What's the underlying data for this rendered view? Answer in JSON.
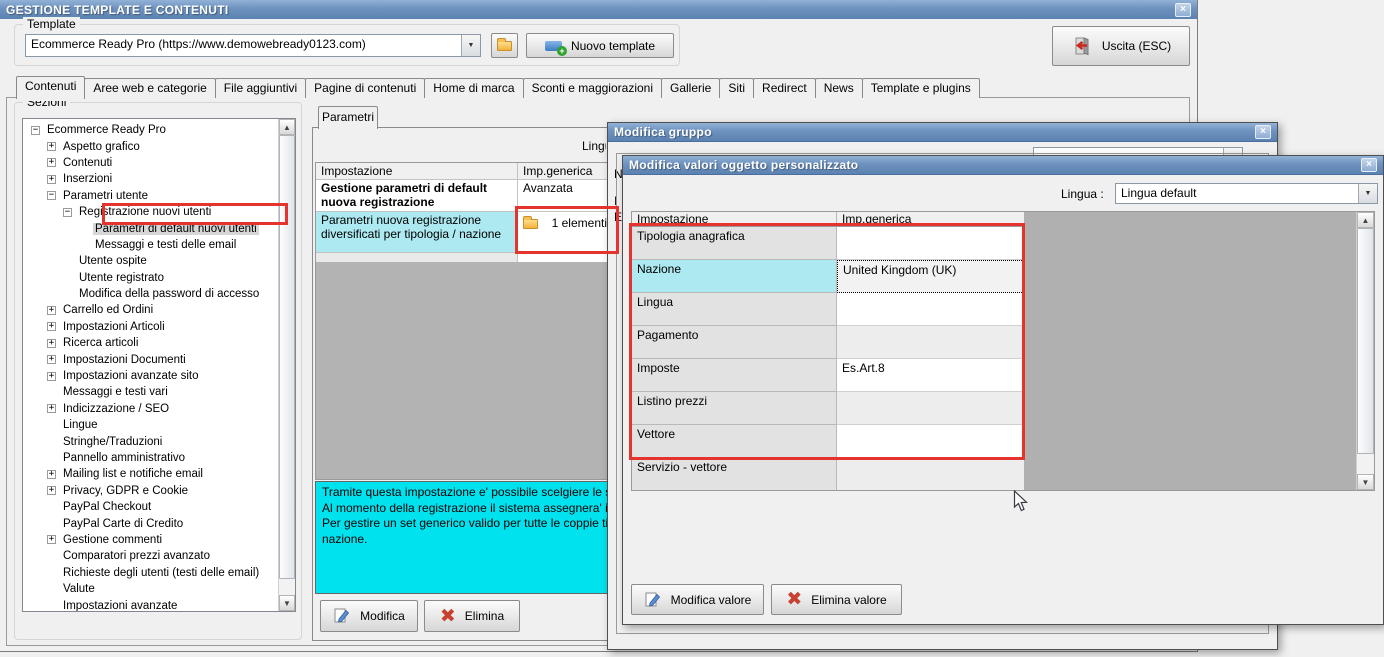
{
  "window": {
    "title": "GESTIONE TEMPLATE E CONTENUTI",
    "template_group": {
      "label": "Template",
      "combo_value": "Ecommerce Ready Pro (https://www.demowebready0123.com)",
      "new_template_label": "Nuovo template"
    },
    "exit_label": "Uscita (ESC)",
    "tabs": [
      "Contenuti",
      "Aree web e categorie",
      "File aggiuntivi",
      "Pagine di contenuti",
      "Home di marca",
      "Sconti e maggiorazioni",
      "Gallerie",
      "Siti",
      "Redirect",
      "News",
      "Template e plugins"
    ],
    "active_tab": "Contenuti"
  },
  "sections": {
    "label": "Sezioni",
    "tree": [
      {
        "label": "Ecommerce Ready Pro",
        "level": 0,
        "state": "minus"
      },
      {
        "label": "Aspetto grafico",
        "level": 1,
        "state": "plus"
      },
      {
        "label": "Contenuti",
        "level": 1,
        "state": "plus"
      },
      {
        "label": "Inserzioni",
        "level": 1,
        "state": "plus"
      },
      {
        "label": "Parametri utente",
        "level": 1,
        "state": "minus"
      },
      {
        "label": "Registrazione nuovi utenti",
        "level": 2,
        "state": "minus"
      },
      {
        "label": "Parametri di default nuovi utenti",
        "level": 3,
        "state": "leaf",
        "selected": true
      },
      {
        "label": "Messaggi e testi delle email",
        "level": 3,
        "state": "leaf"
      },
      {
        "label": "Utente ospite",
        "level": 2,
        "state": "leaf"
      },
      {
        "label": "Utente registrato",
        "level": 2,
        "state": "leaf"
      },
      {
        "label": "Modifica della password di accesso",
        "level": 2,
        "state": "leaf"
      },
      {
        "label": "Carrello ed Ordini",
        "level": 1,
        "state": "plus"
      },
      {
        "label": "Impostazioni Articoli",
        "level": 1,
        "state": "plus"
      },
      {
        "label": "Ricerca articoli",
        "level": 1,
        "state": "plus"
      },
      {
        "label": "Impostazioni Documenti",
        "level": 1,
        "state": "plus"
      },
      {
        "label": "Impostazioni avanzate sito",
        "level": 1,
        "state": "plus"
      },
      {
        "label": "Messaggi e testi vari",
        "level": 1,
        "state": "leaf"
      },
      {
        "label": "Indicizzazione / SEO",
        "level": 1,
        "state": "plus"
      },
      {
        "label": "Lingue",
        "level": 1,
        "state": "leaf"
      },
      {
        "label": "Stringhe/Traduzioni",
        "level": 1,
        "state": "leaf"
      },
      {
        "label": "Pannello amministrativo",
        "level": 1,
        "state": "leaf"
      },
      {
        "label": "Mailing list e notifiche email",
        "level": 1,
        "state": "plus"
      },
      {
        "label": "Privacy, GDPR e Cookie",
        "level": 1,
        "state": "plus"
      },
      {
        "label": "PayPal Checkout",
        "level": 1,
        "state": "leaf"
      },
      {
        "label": "PayPal Carte di Credito",
        "level": 1,
        "state": "leaf"
      },
      {
        "label": "Gestione commenti",
        "level": 1,
        "state": "plus"
      },
      {
        "label": "Comparatori prezzi avanzato",
        "level": 1,
        "state": "leaf"
      },
      {
        "label": "Richieste degli utenti (testi delle email)",
        "level": 1,
        "state": "leaf"
      },
      {
        "label": "Valute",
        "level": 1,
        "state": "leaf"
      },
      {
        "label": "Impostazioni avanzate",
        "level": 1,
        "state": "leaf"
      }
    ]
  },
  "content": {
    "tab_label": "Parametri",
    "lingua_label": "Lingua",
    "table": {
      "col1": "Impostazione",
      "col2": "Imp.generica",
      "row1": {
        "name": "Gestione parametri di default nuova registrazione (obbligatorio)",
        "value": "Avanzata"
      },
      "row2": {
        "name": "Parametri nuova registrazione diversificati per tipologia / nazione",
        "value": "1 elementi"
      }
    },
    "help_lines": [
      "Tramite questa impostazione e' possibile scelgiere le specifiche",
      "Al momento della registrazione il sistema assegnera' il set di",
      "Per gestire un set generico valido per tutte le coppie tipologia",
      "nazione."
    ],
    "modify_label": "Modifica",
    "delete_label": "Elimina"
  },
  "dialog_group": {
    "title": "Modifica gruppo",
    "clipped_labels": [
      "N",
      "I",
      "E"
    ]
  },
  "dialog_values": {
    "title": "Modifica valori oggetto personalizzato",
    "lingua_label": "Lingua :",
    "lingua_value": "Lingua default",
    "table": {
      "col1": "Impostazione",
      "col2": "Imp.generica",
      "rows": [
        {
          "name": "Tipologia anagrafica",
          "value": ""
        },
        {
          "name": "Nazione",
          "value": "United Kingdom (UK)",
          "selected": true
        },
        {
          "name": "Lingua",
          "value": ""
        },
        {
          "name": "Pagamento",
          "value": ""
        },
        {
          "name": "Imposte",
          "value": "Es.Art.8"
        },
        {
          "name": "Listino prezzi",
          "value": ""
        },
        {
          "name": "Vettore",
          "value": ""
        },
        {
          "name": "Servizio - vettore",
          "value": ""
        }
      ]
    },
    "modify_label": "Modifica valore",
    "delete_label": "Elimina valore"
  },
  "colors": {
    "titlebar_top": "#92b1d6",
    "titlebar_bottom": "#5c82b1",
    "row_highlight_cyan": "#ace9f0",
    "help_cyan": "#00e3ef",
    "annotation_red": "#e5342e",
    "table_filler_gray": "#b3b3b3"
  }
}
